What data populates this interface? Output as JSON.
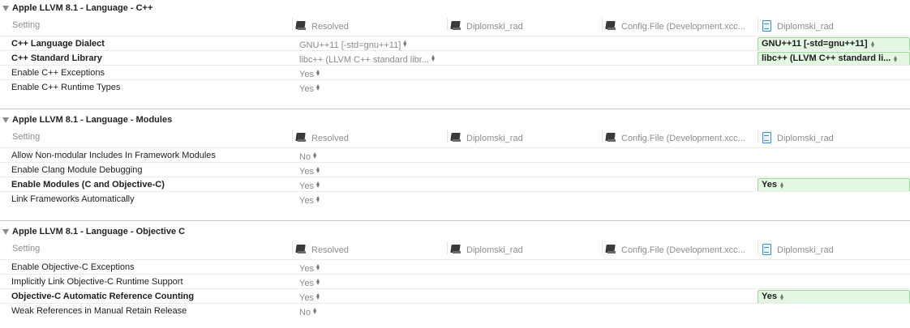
{
  "columns": {
    "setting": "Setting",
    "resolved": "Resolved",
    "target": "Diplomski_rad",
    "config": "Config.File (Development.xcc...",
    "project": "Diplomski_rad"
  },
  "sections": [
    {
      "title": "Apple LLVM 8.1 - Language - C++",
      "rows": [
        {
          "name": "C++ Language Dialect",
          "bold": true,
          "resolved": "GNU++11 [-std=gnu++11]",
          "override": "GNU++11 [-std=gnu++11]"
        },
        {
          "name": "C++ Standard Library",
          "bold": true,
          "resolved": "libc++ (LLVM C++ standard libr...",
          "override": "libc++ (LLVM C++ standard li..."
        },
        {
          "name": "Enable C++ Exceptions",
          "bold": false,
          "resolved": "Yes",
          "override": ""
        },
        {
          "name": "Enable C++ Runtime Types",
          "bold": false,
          "resolved": "Yes",
          "override": ""
        }
      ]
    },
    {
      "title": "Apple LLVM 8.1 - Language - Modules",
      "rows": [
        {
          "name": "Allow Non-modular Includes In Framework Modules",
          "bold": false,
          "resolved": "No",
          "override": ""
        },
        {
          "name": "Enable Clang Module Debugging",
          "bold": false,
          "resolved": "Yes",
          "override": ""
        },
        {
          "name": "Enable Modules (C and Objective-C)",
          "bold": true,
          "resolved": "Yes",
          "override": "Yes"
        },
        {
          "name": "Link Frameworks Automatically",
          "bold": false,
          "resolved": "Yes",
          "override": ""
        }
      ]
    },
    {
      "title": "Apple LLVM 8.1 - Language - Objective C",
      "rows": [
        {
          "name": "Enable Objective-C Exceptions",
          "bold": false,
          "resolved": "Yes",
          "override": ""
        },
        {
          "name": "Implicitly Link Objective-C Runtime Support",
          "bold": false,
          "resolved": "Yes",
          "override": ""
        },
        {
          "name": "Objective-C Automatic Reference Counting",
          "bold": true,
          "resolved": "Yes",
          "override": "Yes"
        },
        {
          "name": "Weak References in Manual Retain Release",
          "bold": false,
          "resolved": "No",
          "override": ""
        }
      ]
    }
  ]
}
